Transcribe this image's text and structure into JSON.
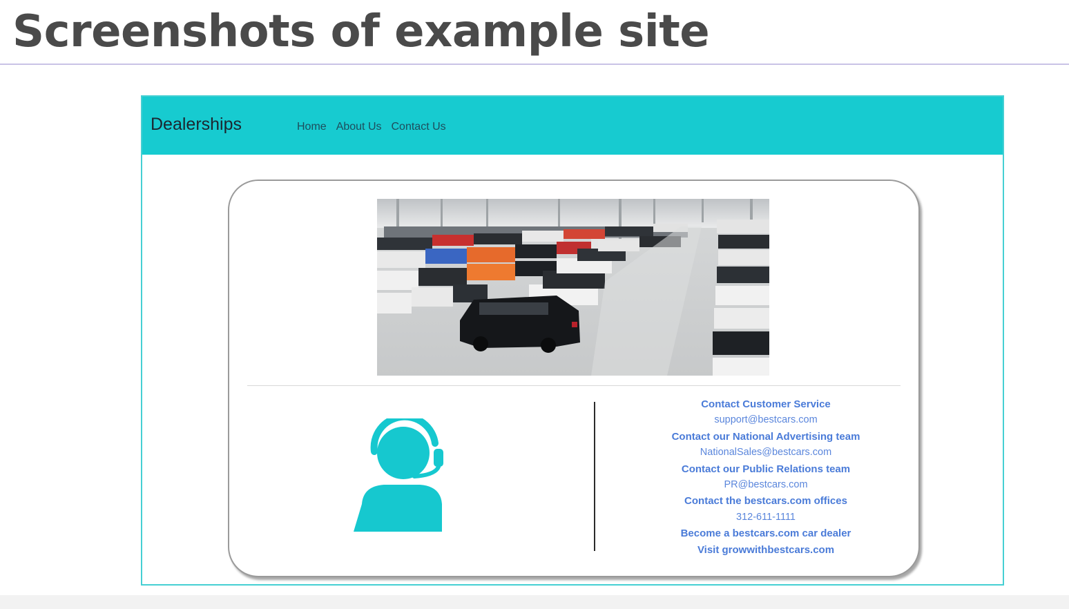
{
  "slide": {
    "title": "Screenshots of example site"
  },
  "site": {
    "brand": "Dealerships",
    "nav": [
      "Home",
      "About Us",
      "Contact Us"
    ],
    "contacts": [
      {
        "text": "Contact Customer Service",
        "kind": "heading"
      },
      {
        "text": "support@bestcars.com",
        "kind": "value"
      },
      {
        "text": "Contact our National Advertising team",
        "kind": "heading"
      },
      {
        "text": "NationalSales@bestcars.com",
        "kind": "value"
      },
      {
        "text": "Contact our Public Relations team",
        "kind": "heading"
      },
      {
        "text": "PR@bestcars.com",
        "kind": "value"
      },
      {
        "text": "Contact the bestcars.com offices",
        "kind": "heading"
      },
      {
        "text": "312-611-1111",
        "kind": "value"
      },
      {
        "text": "Become a bestcars.com car dealer",
        "kind": "heading"
      },
      {
        "text": "Visit growwithbestcars.com",
        "kind": "heading"
      }
    ],
    "hero_image": "car-dealership-showroom-photo",
    "support_icon": "customer-support-headset-icon"
  },
  "colors": {
    "navbar": "#17cbd0",
    "accent_teal": "#16c8cf",
    "contact_blue": "#4a7bd8",
    "slide_title": "#4a4a4a"
  }
}
